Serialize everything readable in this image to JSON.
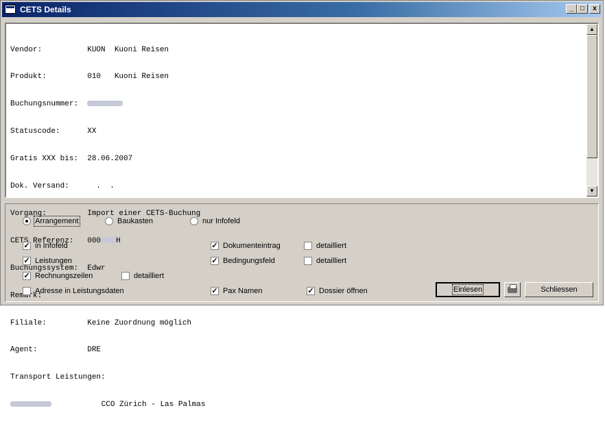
{
  "window": {
    "title": "CETS Details"
  },
  "titlebar_buttons": {
    "minimize": "_",
    "maximize": "□",
    "close": "x"
  },
  "details": {
    "lines": [
      [
        "Vendor:          ",
        "KUON  Kuoni Reisen"
      ],
      [
        "Produkt:         ",
        "010   Kuoni Reisen"
      ],
      [
        "Buchungsnummer:  ",
        ""
      ],
      [
        "Statuscode:      ",
        "XX"
      ],
      [
        "Gratis XXX bis:  ",
        "28.06.2007"
      ],
      [
        "Dok. Versand:    ",
        "  .  ."
      ],
      [
        "Vorgang:         ",
        "Import einer CETS-Buchung"
      ],
      [
        "CETS Referenz:   ",
        "000",
        "H"
      ],
      [
        "Buchungssystem:  ",
        "Edwr"
      ],
      [
        "Remark:          ",
        ""
      ],
      [
        "Filiale:         ",
        "Keine Zuordnung möglich"
      ],
      [
        "Agent:           ",
        "DRE"
      ],
      [
        "Transport Leistungen:",
        ""
      ],
      [
        "",
        "           ",
        "CCO Zürich - Las Palmas"
      ]
    ]
  },
  "scrollbar": {
    "up": "▲",
    "down": "▼"
  },
  "options": {
    "radio_arrangement": "Arrangement",
    "radio_baukasten": "Baukasten",
    "radio_nur_infofeld": "nur Infofeld",
    "chk_in_infofeld": "in Infofeld",
    "chk_leistungen": "Leistungen",
    "chk_rechnungszeilen": "Rechnungszeilen",
    "chk_detailliert_3": "detailliert",
    "chk_adresse": "Adresse in Leistungsdaten",
    "chk_dokumenteintrag": "Dokumenteintrag",
    "chk_detailliert_1": "detailliert",
    "chk_bedingungsfeld": "Bedingungsfeld",
    "chk_detailliert_2": "detailliert",
    "chk_pax_namen": "Pax Namen",
    "chk_dossier_oeffnen": "Dossier öffnen",
    "check_mark": "✓"
  },
  "buttons": {
    "einlesen": "Einlesen",
    "schliessen": "Schliessen"
  }
}
